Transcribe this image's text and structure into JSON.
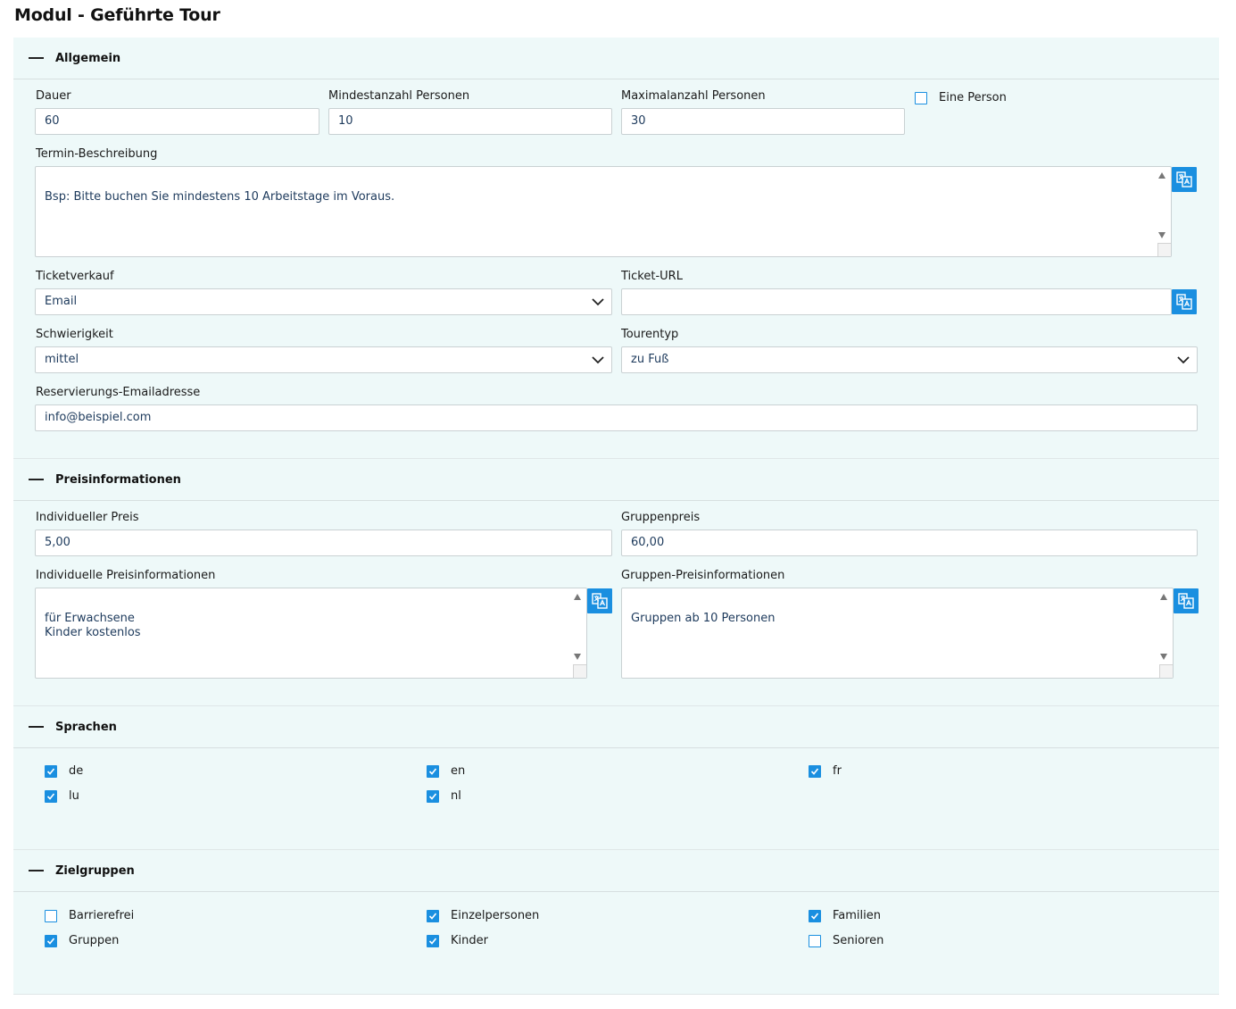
{
  "page": {
    "title": "Modul - Geführte Tour"
  },
  "sections": {
    "allgemein": {
      "title": "Allgemein",
      "dauer": {
        "label": "Dauer",
        "value": "60"
      },
      "min_personen": {
        "label": "Mindestanzahl Personen",
        "value": "10"
      },
      "max_personen": {
        "label": "Maximalanzahl Personen",
        "value": "30"
      },
      "eine_person": {
        "label": "Eine Person",
        "checked": false
      },
      "termin": {
        "label": "Termin-Beschreibung",
        "value": "Bsp: Bitte buchen Sie mindestens 10 Arbeitstage im Voraus."
      },
      "ticketverkauf": {
        "label": "Ticketverkauf",
        "value": "Email"
      },
      "ticket_url": {
        "label": "Ticket-URL",
        "value": ""
      },
      "schwierigkeit": {
        "label": "Schwierigkeit",
        "value": "mittel"
      },
      "tourentyp": {
        "label": "Tourentyp",
        "value": "zu Fuß"
      },
      "reservierung": {
        "label": "Reservierungs-Emailadresse",
        "value": "info@beispiel.com"
      }
    },
    "preis": {
      "title": "Preisinformationen",
      "individuell": {
        "label": "Individueller Preis",
        "value": "5,00"
      },
      "gruppenpreis": {
        "label": "Gruppenpreis",
        "value": "60,00"
      },
      "individuell_info": {
        "label": "Individuelle Preisinformationen",
        "value": "für Erwachsene\nKinder kostenlos"
      },
      "gruppen_info": {
        "label": "Gruppen-Preisinformationen",
        "value": "Gruppen ab 10 Personen"
      }
    },
    "sprachen": {
      "title": "Sprachen",
      "items": [
        {
          "label": "de",
          "checked": true
        },
        {
          "label": "en",
          "checked": true
        },
        {
          "label": "fr",
          "checked": true
        },
        {
          "label": "lu",
          "checked": true
        },
        {
          "label": "nl",
          "checked": true
        }
      ]
    },
    "zielgruppen": {
      "title": "Zielgruppen",
      "items": [
        {
          "label": "Barrierefrei",
          "checked": false
        },
        {
          "label": "Einzelpersonen",
          "checked": true
        },
        {
          "label": "Familien",
          "checked": true
        },
        {
          "label": "Gruppen",
          "checked": true
        },
        {
          "label": "Kinder",
          "checked": true
        },
        {
          "label": "Senioren",
          "checked": false
        }
      ]
    }
  },
  "colors": {
    "accent": "#1a8fe0",
    "section_bg": "#eef9f9",
    "input_text": "#1d3a5c"
  },
  "icons": {
    "translate": "translate-icon",
    "collapse": "collapse-icon",
    "chevron": "chevron-down-icon",
    "check": "check-icon"
  }
}
